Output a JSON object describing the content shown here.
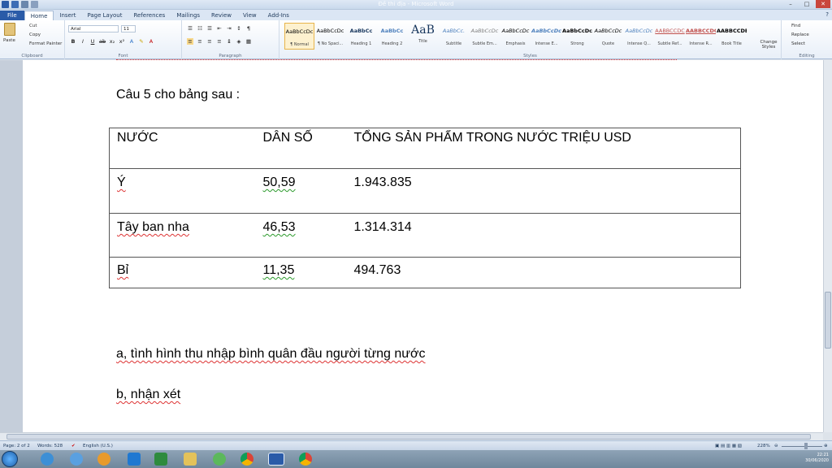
{
  "window": {
    "title": "Đề thi địa - Microsoft Word"
  },
  "ribbon_tabs": [
    "File",
    "Home",
    "Insert",
    "Page Layout",
    "References",
    "Mailings",
    "Review",
    "View",
    "Add-Ins"
  ],
  "clipboard": {
    "paste": "Paste",
    "cut": "Cut",
    "copy": "Copy",
    "format_painter": "Format Painter",
    "label": "Clipboard"
  },
  "font": {
    "name": "Arial",
    "size": "11",
    "label": "Font"
  },
  "paragraph": {
    "label": "Paragraph"
  },
  "styles": {
    "label": "Styles",
    "items": [
      {
        "sample": "AaBbCcDc",
        "name": "¶ Normal"
      },
      {
        "sample": "AaBbCcDc",
        "name": "¶ No Spaci..."
      },
      {
        "sample": "AaBbCc",
        "name": "Heading 1"
      },
      {
        "sample": "AaBbCc",
        "name": "Heading 2"
      },
      {
        "sample": "AaB",
        "name": "Title"
      },
      {
        "sample": "AaBbCc.",
        "name": "Subtitle"
      },
      {
        "sample": "AaBbCcDc",
        "name": "Subtle Em..."
      },
      {
        "sample": "AaBbCcDc",
        "name": "Emphasis"
      },
      {
        "sample": "AaBbCcDc",
        "name": "Intense E..."
      },
      {
        "sample": "AaBbCcDc",
        "name": "Strong"
      },
      {
        "sample": "AaBbCcDc",
        "name": "Quote"
      },
      {
        "sample": "AaBbCcDc",
        "name": "Intense Q..."
      },
      {
        "sample": "AABBCCDC",
        "name": "Subtle Ref..."
      },
      {
        "sample": "AABBCCDC",
        "name": "Intense R..."
      },
      {
        "sample": "AABBCCDE",
        "name": "Book Title"
      }
    ],
    "change_styles": "Change Styles"
  },
  "editing": {
    "label": "Editing",
    "find": "Find",
    "replace": "Replace",
    "select": "Select"
  },
  "document": {
    "heading": "Câu 5 cho bảng sau :",
    "table": {
      "headers": [
        "NƯỚC",
        "DÂN SỐ",
        "TỔNG SẢN PHẨM TRONG NƯỚC TRIỆU USD"
      ],
      "rows": [
        [
          "Ý",
          "50,59",
          "1.943.835"
        ],
        [
          "Tây ban nha",
          "46,53",
          "1.314.314"
        ],
        [
          "Bỉ",
          "11,35",
          "494.763"
        ]
      ]
    },
    "question_a": "a, tình hình thu nhập bình quân đầu người từng nước",
    "question_b": "b, nhận xét"
  },
  "status_bar": {
    "page": "Page: 2 of 2",
    "words": "Words: 528",
    "language": "English (U.S.)",
    "zoom": "228%"
  },
  "taskbar": {
    "time": "22:21",
    "date": "30/06/2020"
  }
}
